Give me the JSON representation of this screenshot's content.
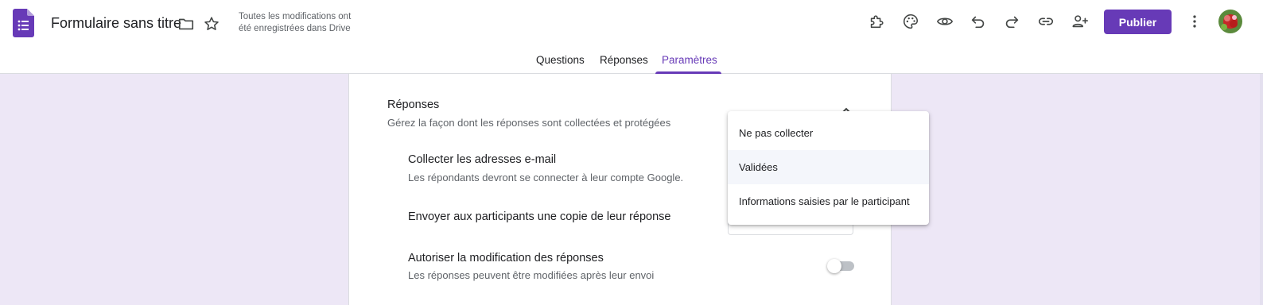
{
  "header": {
    "title": "Formulaire sans titre",
    "save_status": "Toutes les modifications ont été enregistrées dans Drive",
    "publish_label": "Publier"
  },
  "tabs": [
    {
      "label": "Questions",
      "active": false
    },
    {
      "label": "Réponses",
      "active": false
    },
    {
      "label": "Paramètres",
      "active": true
    }
  ],
  "section": {
    "title": "Réponses",
    "description": "Gérez la façon dont les réponses sont collectées et protégées"
  },
  "settings": {
    "collect_email": {
      "title": "Collecter les adresses e-mail",
      "description": "Les répondants devront se connecter à leur compte Google."
    },
    "send_copy": {
      "title": "Envoyer aux participants une copie de leur réponse"
    },
    "allow_edit": {
      "title": "Autoriser la modification des réponses",
      "description": "Les réponses peuvent être modifiées après leur envoi",
      "enabled": false
    }
  },
  "dropdown": {
    "options": [
      "Ne pas collecter",
      "Validées",
      "Informations saisies par le participant"
    ],
    "highlighted_index": 1
  },
  "colors": {
    "accent": "#673ab7",
    "background": "#ede7f6"
  },
  "icons": [
    "forms-logo-icon",
    "folder-icon",
    "star-icon",
    "addon-puzzle-icon",
    "palette-icon",
    "preview-eye-icon",
    "undo-icon",
    "redo-icon",
    "link-icon",
    "add-collaborator-icon",
    "more-vert-icon",
    "chevron-up-icon"
  ]
}
